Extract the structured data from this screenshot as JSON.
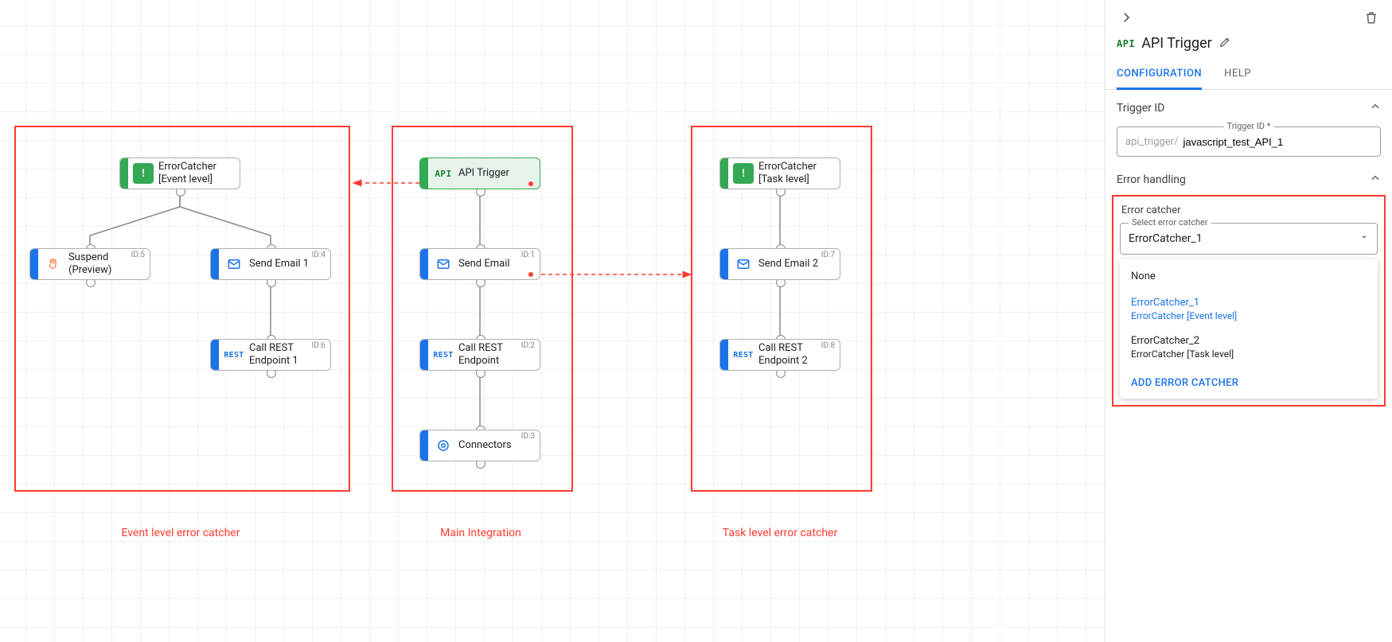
{
  "canvas": {
    "groups": {
      "event": {
        "label": "Event level error catcher"
      },
      "main": {
        "label": "Main Integration"
      },
      "task": {
        "label": "Task level error catcher"
      }
    },
    "nodes": {
      "apiTrigger": {
        "title": "API Trigger"
      },
      "errEvent": {
        "title1": "ErrorCatcher",
        "title2": "[Event level]"
      },
      "errTask": {
        "title1": "ErrorCatcher",
        "title2": "[Task level]"
      },
      "suspend": {
        "title1": "Suspend",
        "title2": "(Preview)",
        "id": "ID:5"
      },
      "sendEmail1": {
        "title": "Send Email 1",
        "id": "ID:4"
      },
      "callRest1": {
        "title1": "Call REST",
        "title2": "Endpoint 1",
        "id": "ID:6"
      },
      "sendEmail": {
        "title": "Send Email",
        "id": "ID:1"
      },
      "callRest": {
        "title1": "Call REST",
        "title2": "Endpoint",
        "id": "ID:2"
      },
      "connectors": {
        "title": "Connectors",
        "id": "ID:3"
      },
      "sendEmail2": {
        "title": "Send Email 2",
        "id": "ID:7"
      },
      "callRest2": {
        "title1": "Call REST",
        "title2": "Endpoint 2",
        "id": "ID:8"
      }
    }
  },
  "panel": {
    "title": "API Trigger",
    "tabs": {
      "config": "CONFIGURATION",
      "help": "HELP"
    },
    "sections": {
      "triggerId": {
        "header": "Trigger ID",
        "fieldLabel": "Trigger ID *",
        "prefix": "api_trigger/",
        "value": "javascript_test_API_1"
      },
      "errorHandling": {
        "header": "Error handling",
        "boxLabel": "Error catcher",
        "selectLabel": "Select error catcher",
        "selected": "ErrorCatcher_1",
        "options": {
          "none": {
            "name": "None"
          },
          "ec1": {
            "name": "ErrorCatcher_1",
            "sub": "ErrorCatcher [Event level]"
          },
          "ec2": {
            "name": "ErrorCatcher_2",
            "sub": "ErrorCatcher [Task level]"
          }
        },
        "addLabel": "ADD ERROR CATCHER"
      }
    },
    "iconText": {
      "api": "API",
      "rest": "REST"
    }
  }
}
